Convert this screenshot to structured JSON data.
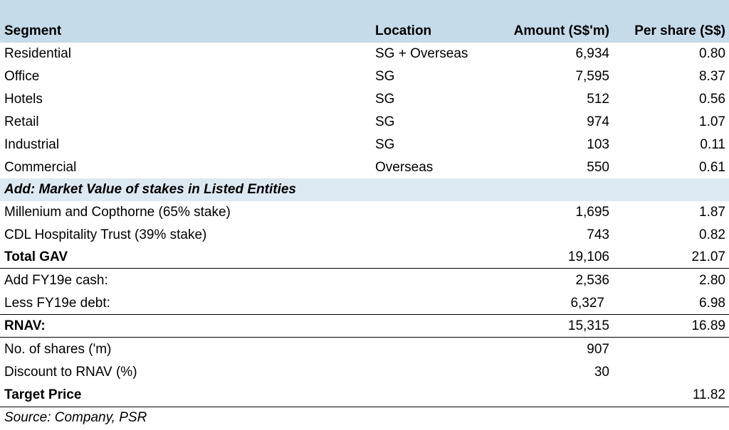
{
  "header": {
    "segment": "Segment",
    "location": "Location",
    "amount": "Amount (S$'m)",
    "per_share": "Per share (S$)"
  },
  "segments": [
    {
      "name": "Residential",
      "location": "SG + Overseas",
      "amount": "6,934",
      "per_share": "0.80"
    },
    {
      "name": "Office",
      "location": "SG",
      "amount": "7,595",
      "per_share": "8.37"
    },
    {
      "name": "Hotels",
      "location": "SG",
      "amount": "512",
      "per_share": "0.56"
    },
    {
      "name": "Retail",
      "location": "SG",
      "amount": "974",
      "per_share": "1.07"
    },
    {
      "name": "Industrial",
      "location": "SG",
      "amount": "103",
      "per_share": "0.11"
    },
    {
      "name": "Commercial",
      "location": "Overseas",
      "amount": "550",
      "per_share": "0.61"
    }
  ],
  "listed_header": "Add: Market Value of stakes in Listed Entities",
  "listed": [
    {
      "name": "Millenium and Copthorne (65% stake)",
      "amount": "1,695",
      "per_share": "1.87"
    },
    {
      "name": "CDL Hospitality Trust (39% stake)",
      "amount": "743",
      "per_share": "0.82"
    }
  ],
  "total_gav": {
    "label": "Total GAV",
    "amount": "19,106",
    "per_share": "21.07"
  },
  "cash": {
    "label": "Add FY19e cash:",
    "amount": "2,536",
    "per_share": "2.80"
  },
  "debt": {
    "label": "Less FY19e debt:",
    "amount": "6,327",
    "per_share": "6.98"
  },
  "rnav": {
    "label": "RNAV:",
    "amount": "15,315",
    "per_share": "16.89"
  },
  "shares": {
    "label": "No. of shares ('m)",
    "amount": "907"
  },
  "discount": {
    "label": "Discount to RNAV (%)",
    "amount": "30"
  },
  "target": {
    "label": "Target Price",
    "per_share": "11.82"
  },
  "source": "Source: Company, PSR",
  "colors": {
    "header_bg": "#c5dbe9",
    "subheader_bg": "#dde9f2"
  }
}
